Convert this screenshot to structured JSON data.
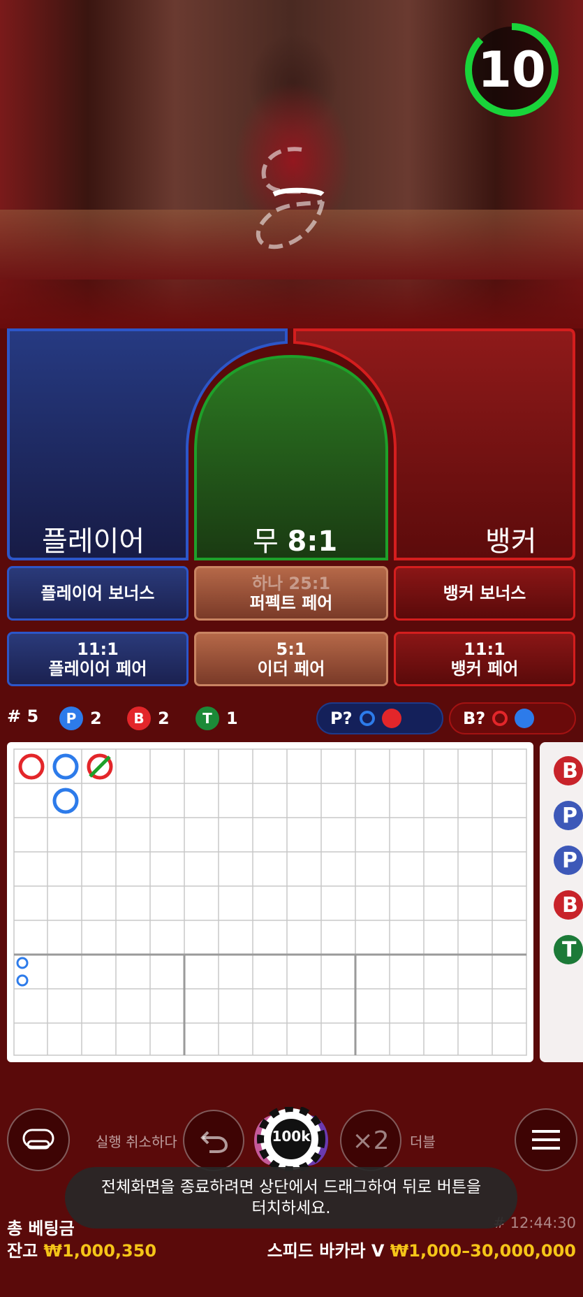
{
  "timer": {
    "value": "10"
  },
  "main_bets": {
    "player": {
      "label": "플레이어"
    },
    "tie": {
      "label": "무",
      "odds": "8:1"
    },
    "banker": {
      "label": "뱅커"
    }
  },
  "side_bets": {
    "player_bonus": {
      "label": "플레이어 보너스"
    },
    "perfect_pair": {
      "odds": "하나 25:1",
      "label": "퍼펙트 페어"
    },
    "banker_bonus": {
      "label": "뱅커 보너스"
    },
    "player_pair": {
      "odds": "11:1",
      "label": "플레이어 페어"
    },
    "either_pair": {
      "odds": "5:1",
      "label": "이더 페어"
    },
    "banker_pair": {
      "odds": "11:1",
      "label": "뱅커 페어"
    }
  },
  "stats": {
    "round": "# 5",
    "player": {
      "letter": "P",
      "count": "2"
    },
    "banker": {
      "letter": "B",
      "count": "2"
    },
    "tie": {
      "letter": "T",
      "count": "1"
    },
    "player_predict": "P?",
    "banker_predict": "B?"
  },
  "bead_road": {
    "items": [
      "B",
      "P",
      "P",
      "B",
      "T"
    ]
  },
  "controls": {
    "undo_label": "실행 취소하다",
    "chip_value": "100k",
    "double_symbol": "×2",
    "double_label": "더블"
  },
  "toast": {
    "line1": "전체화면을 종료하려면 상단에서 드래그하여 뒤로 버튼을",
    "line2": "터치하세요."
  },
  "footer": {
    "total_bet_label": "총 베팅금",
    "time": "# 12:44:30",
    "balance_label": "잔고",
    "balance_value": "₩1,000,350",
    "game_name": "스피드 바카라 V",
    "limits": "₩1,000–30,000,000"
  },
  "colors": {
    "player": "#2d56c8",
    "banker": "#d41e1e",
    "tie": "#1ea02a",
    "gold": "#f5c518",
    "timer": "#19d43a"
  }
}
